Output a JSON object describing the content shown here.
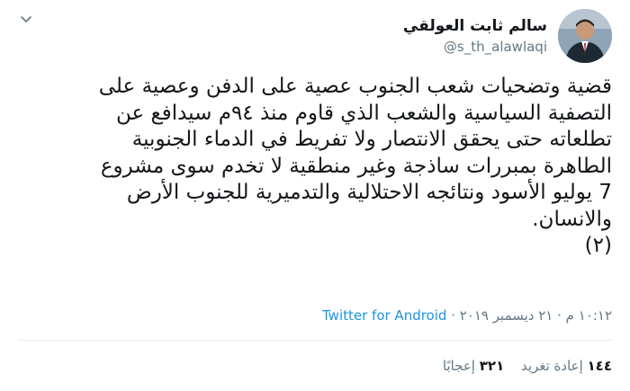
{
  "tweet": {
    "author": {
      "display_name": "سالم ثابت العولقي",
      "handle": "@s_th_alawlaqi"
    },
    "text": "قضية وتضحيات شعب الجنوب عصية على الدفن وعصية على\nالتصفية السياسية والشعب الذي قاوم منذ ٩٤م سيدافع عن\nتطلعاته حتى يحقق الانتصار ولا تفريط في الدماء الجنوبية\nالطاهرة بمبررات ساذجة وغير منطقية لا تخدم سوى مشروع\n7 يوليو الأسود ونتائجه الاحتلالية والتدميرية للجنوب الأرض\nوالانسان.\n(٢)",
    "timestamp": "١٠:١٢ م · ٢١ ديسمبر ٢٠١٩",
    "separator": " · ",
    "source": "Twitter for Android",
    "retweets": {
      "count": "١٤٤",
      "label": "إعادة تغريد"
    },
    "likes": {
      "count": "٣٢١",
      "label": "إعجابًا"
    }
  },
  "colors": {
    "text": "#14171a",
    "secondary": "#657786",
    "link": "#1b95e0",
    "divider": "#e6ecf0"
  },
  "icons": {
    "menu": "chevron-down-icon"
  }
}
